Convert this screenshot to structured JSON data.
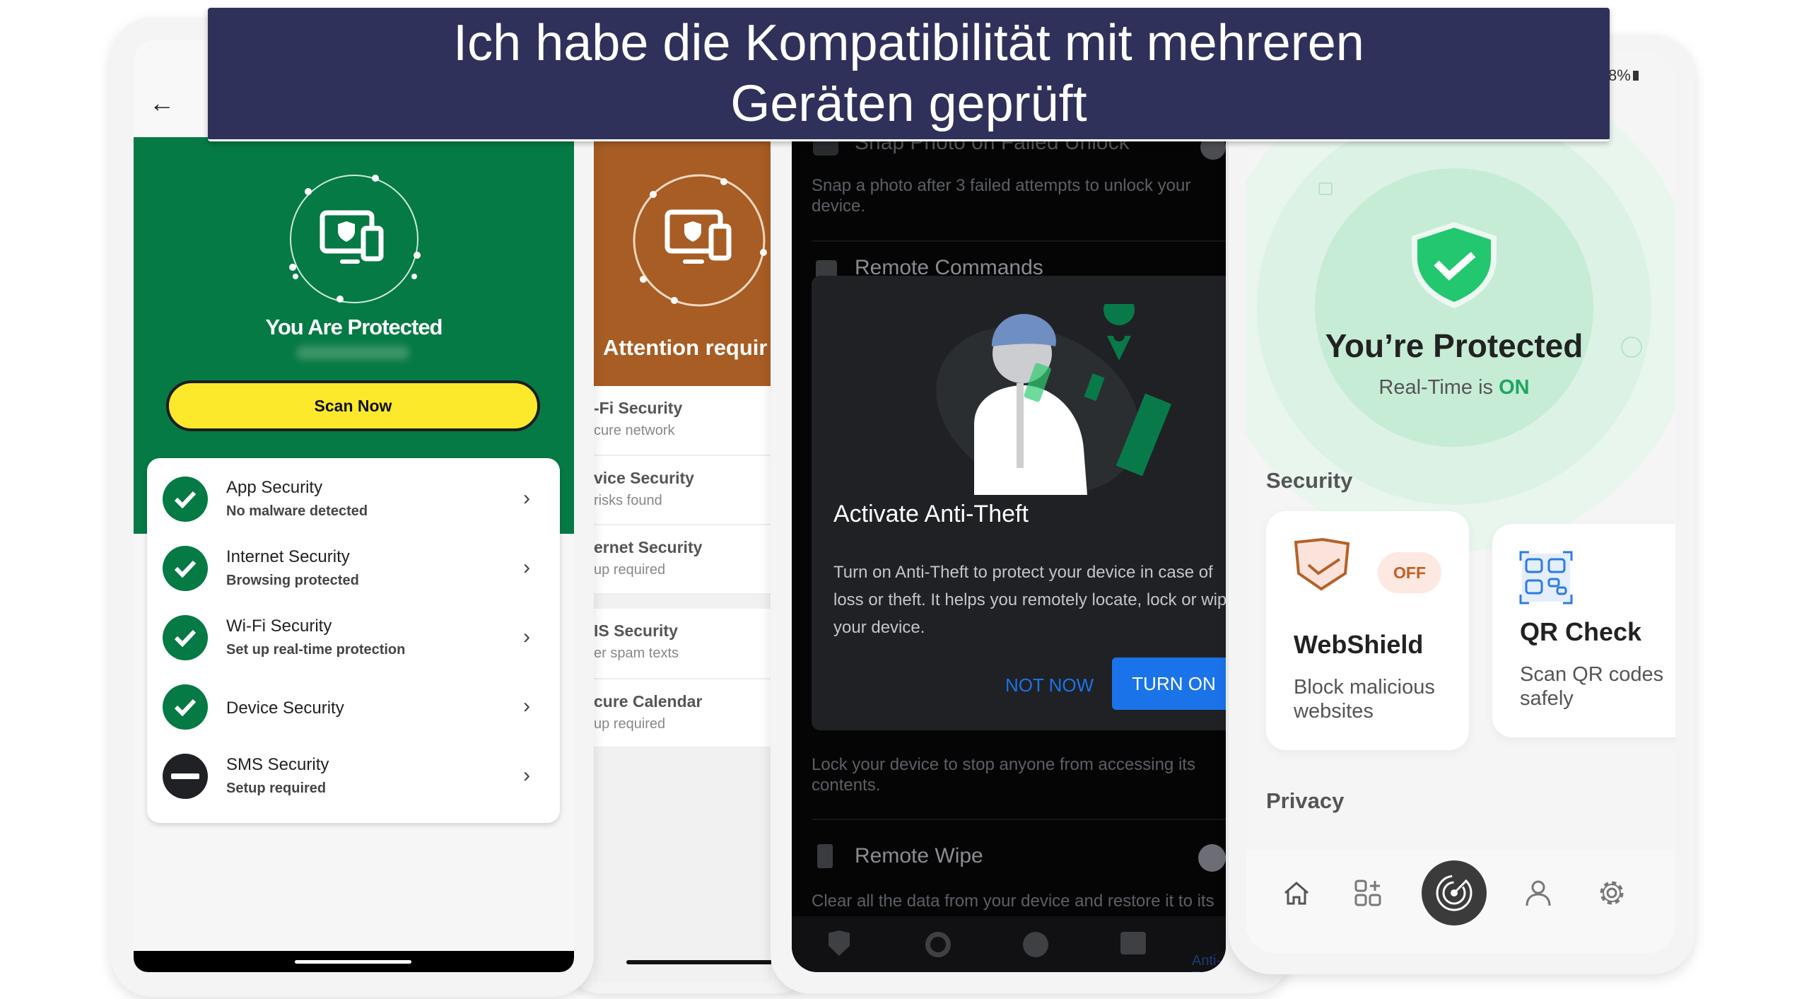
{
  "banner": {
    "line1": "Ich habe die Kompatibilität mit mehreren",
    "line2": "Geräten geprüft",
    "bg": "#30315a"
  },
  "phone1": {
    "back_icon": "arrow-left-icon",
    "status_title": "You Are Protected",
    "scan_button": "Scan Now",
    "accent": "#057a45",
    "button_color": "#fde92b",
    "items": [
      {
        "title": "App Security",
        "subtitle": "No malware detected",
        "status": "ok"
      },
      {
        "title": "Internet Security",
        "subtitle": "Browsing protected",
        "status": "ok"
      },
      {
        "title": "Wi-Fi Security",
        "subtitle": "Set up real-time protection",
        "status": "ok"
      },
      {
        "title": "Device Security",
        "subtitle": "",
        "status": "ok"
      },
      {
        "title": "SMS Security",
        "subtitle": "Setup required",
        "status": "warning"
      }
    ]
  },
  "phone2": {
    "status_title": "Attention requir",
    "accent": "#a85d24",
    "items": [
      {
        "title": "-Fi Security",
        "subtitle": "cure network"
      },
      {
        "title": "vice Security",
        "subtitle": "risks found"
      },
      {
        "title": "ernet Security",
        "subtitle": "up required"
      },
      {
        "title": "IS Security",
        "subtitle": "er spam texts"
      },
      {
        "title": "cure Calendar",
        "subtitle": "up required"
      }
    ]
  },
  "phone3": {
    "snap_title": "Snap Photo on Failed Unlock",
    "snap_desc": "Snap a photo after 3 failed attempts to unlock your device.",
    "remote_commands": "Remote Commands",
    "dialog": {
      "title": "Activate Anti-Theft",
      "body": "Turn on Anti-Theft to protect your device in case of loss or theft. It helps you remotely locate, lock or wipe your device.",
      "not_now": "NOT NOW",
      "turn_on": "TURN ON"
    },
    "lock_desc": "Lock your device to stop anyone from accessing its contents.",
    "remote_wipe": "Remote Wipe",
    "wipe_desc": "Clear all the data from your device and restore it to its",
    "nav_active_label": "Anti-T",
    "nav_icons": [
      "shield-check-icon",
      "scan-icon",
      "globe-icon",
      "message-alert-icon",
      "anti-theft-icon"
    ],
    "accent": "#1a73e8"
  },
  "phone4": {
    "battery": "8%",
    "status_title": "You’re Protected",
    "realtime_prefix": "Real-Time is",
    "realtime_state": "ON",
    "section_security": "Security",
    "section_privacy": "Privacy",
    "webshield": {
      "title": "WebShield",
      "desc": "Block malicious websites",
      "badge": "OFF"
    },
    "qrcheck": {
      "title": "QR Check",
      "desc": "Scan QR codes safely"
    },
    "nav_icons": [
      "home-icon",
      "apps-add-icon",
      "scan-radar-icon",
      "profile-icon",
      "settings-icon"
    ],
    "accent": "#22c770"
  }
}
